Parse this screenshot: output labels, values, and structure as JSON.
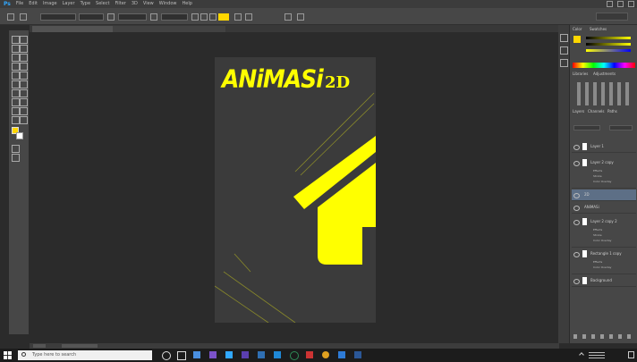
{
  "app": {
    "logo": "Ps"
  },
  "menu": [
    "File",
    "Edit",
    "Image",
    "Layer",
    "Type",
    "Select",
    "Filter",
    "3D",
    "View",
    "Window",
    "Help"
  ],
  "document": {
    "title_main": "ANiMASi",
    "title_suffix": "2D",
    "accent_color": "#ffff00",
    "canvas_color": "#3b3b3b"
  },
  "tools": {
    "foreground_color": "#ffd700",
    "background_color": "#ffffff"
  },
  "panels": {
    "color_tabs": [
      "Color",
      "Swatches"
    ],
    "adjust_tabs": [
      "Libraries",
      "Adjustments"
    ],
    "layer_tabs": [
      "Layers",
      "Channels",
      "Paths"
    ],
    "layers": [
      {
        "name": "Layer 1"
      },
      {
        "name": "Layer 2 copy",
        "sub": [
          "Effects",
          "Stroke",
          "Color Overlay"
        ]
      },
      {
        "name": "2D"
      },
      {
        "name": "ANiMASi"
      },
      {
        "name": "Layer 2 copy 2",
        "sub": [
          "Effects",
          "Stroke",
          "Color Overlay"
        ]
      },
      {
        "name": "Rectangle 1 copy",
        "sub": [
          "Effects",
          "Color Overlay"
        ]
      },
      {
        "name": "Background"
      }
    ]
  },
  "taskbar": {
    "search_placeholder": "Type here to search"
  }
}
